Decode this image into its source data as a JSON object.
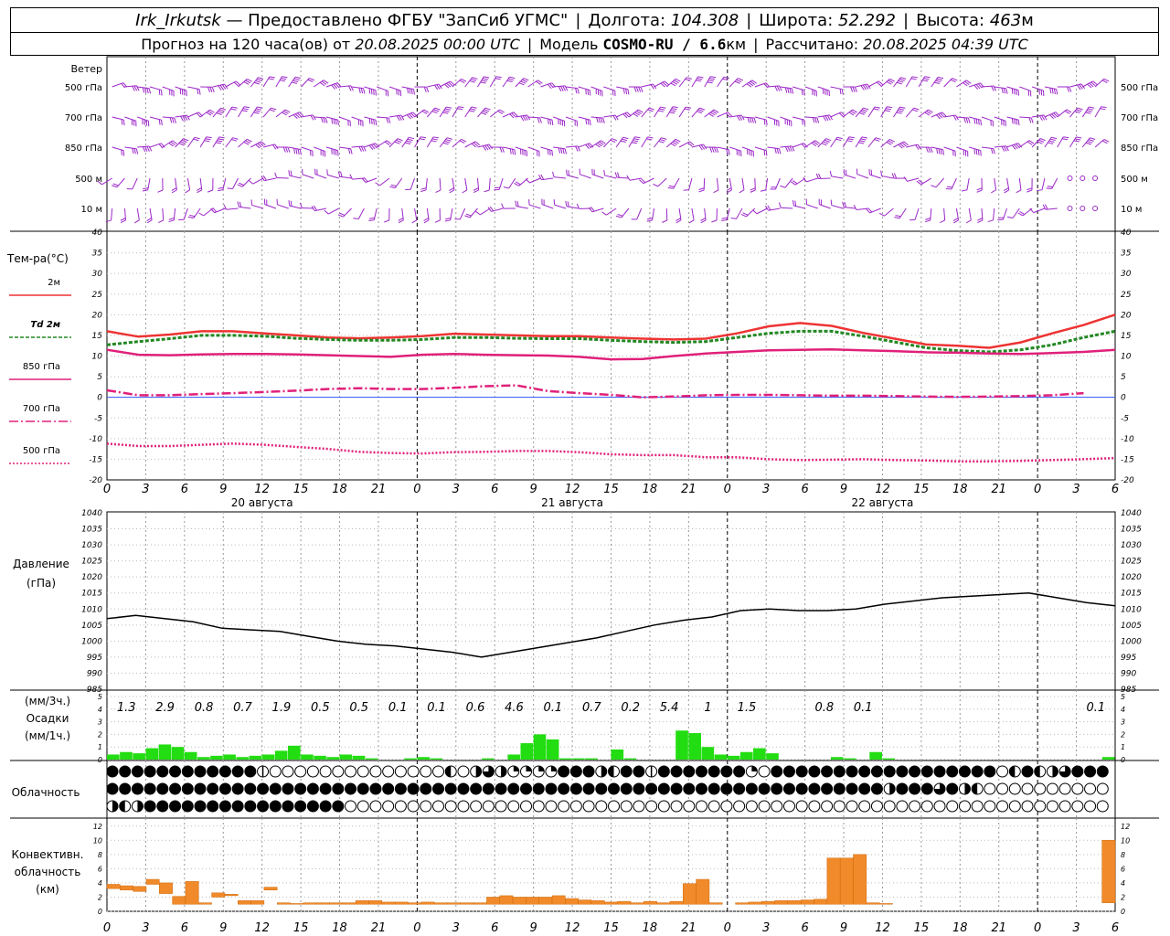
{
  "header": {
    "station": "Irk_Irkutsk",
    "provider": "— Предоставлено ФГБУ \"ЗапСиб УГМС\"",
    "lon_label": "Долгота:",
    "lon": "104.308",
    "lat_label": "Широта:",
    "lat": "52.292",
    "alt_label": "Высота:",
    "alt": "463",
    "alt_unit": "м",
    "forecast_label": "Прогноз на 120 часа(ов) от",
    "forecast_time": "20.08.2025 00:00 UTC",
    "model_label": "Модель",
    "model": "COSMO-RU / 6.6",
    "model_unit": "км",
    "calc_label": "Рассчитано:",
    "calc_time": "20.08.2025 04:39 UTC"
  },
  "panels": {
    "wind_title": "Ветер",
    "wind_levels": [
      "500 гПа",
      "700 гПа",
      "850 гПа",
      "500 м",
      "10 м"
    ],
    "temp_title": "Тем-ра(°С)",
    "temp_legend": [
      {
        "label": "2м",
        "color": "#ee3333",
        "dash": ""
      },
      {
        "label": "Td 2м",
        "color": "#228822",
        "dash": "4,2"
      },
      {
        "label": "850 гПа",
        "color": "#e0207a",
        "dash": ""
      },
      {
        "label": "700 гПа",
        "color": "#e0207a",
        "dash": "10,3,2,3"
      },
      {
        "label": "500 гПа",
        "color": "#e0207a",
        "dash": "2,2"
      }
    ],
    "pressure_title": "Давление",
    "pressure_unit": "(гПа)",
    "precip_unit_3h": "(мм/3ч.)",
    "precip_title": "Осадки",
    "precip_unit_1h": "(мм/1ч.)",
    "cloud_title": "Облачность",
    "conv_title_1": "Конвективн.",
    "conv_title_2": "облачность",
    "conv_unit": "(км)"
  },
  "chart_data": {
    "type": "line",
    "x_hours": [
      0,
      3,
      6,
      9,
      12,
      15,
      18,
      21,
      24,
      27,
      30,
      33,
      36,
      39,
      42,
      45,
      48,
      51,
      54,
      57,
      60,
      63,
      66,
      69,
      72,
      75,
      78
    ],
    "x_tick_labels": [
      "0",
      "3",
      "6",
      "9",
      "12",
      "15",
      "18",
      "21",
      "0",
      "3",
      "6",
      "9",
      "12",
      "15",
      "18",
      "21",
      "0",
      "3",
      "6",
      "9",
      "12",
      "15",
      "18",
      "21",
      "0",
      "3",
      "6"
    ],
    "day_labels": [
      {
        "at_hour": 12,
        "label": "20 августа"
      },
      {
        "at_hour": 36,
        "label": "21 августа"
      },
      {
        "at_hour": 60,
        "label": "22 августа"
      }
    ],
    "temperature": {
      "ylim": [
        -20,
        40
      ],
      "yticks": [
        -20,
        -15,
        -10,
        -5,
        0,
        5,
        10,
        15,
        20,
        25,
        30,
        35,
        40
      ],
      "series": [
        {
          "name": "2м",
          "values": [
            16,
            14.7,
            15.2,
            16,
            16,
            15.5,
            15,
            14.5,
            14.3,
            14.5,
            14.8,
            15.4,
            15.2,
            15,
            14.8,
            14.8,
            14.5,
            14.2,
            14,
            14.2,
            15.5,
            17.2,
            18,
            17.3,
            15.6,
            14.2,
            12.8,
            12.5,
            12,
            13.3,
            15.5,
            17.5,
            20
          ]
        },
        {
          "name": "Td 2м",
          "values": [
            12.7,
            13.5,
            14.2,
            15,
            15,
            14.8,
            14.3,
            14,
            13.8,
            13.8,
            14,
            14.5,
            14.5,
            14.3,
            14.2,
            14.2,
            13.8,
            13.5,
            13.3,
            13.5,
            14.5,
            15.5,
            16,
            16,
            14.8,
            13.4,
            12,
            11.3,
            11,
            11.5,
            12.7,
            14.5,
            16
          ]
        },
        {
          "name": "850 гПа",
          "values": [
            11.5,
            10.3,
            10.2,
            10.4,
            10.5,
            10.5,
            10.4,
            10.2,
            10,
            9.8,
            10.3,
            10.5,
            10.3,
            10.2,
            10.1,
            9.8,
            9.2,
            9.3,
            10,
            10.6,
            11,
            11.4,
            11.5,
            11.6,
            11.4,
            11.2,
            10.9,
            10.8,
            10.6,
            10.5,
            10.7,
            11,
            11.5
          ]
        },
        {
          "name": "700 гПа",
          "values": [
            1.7,
            0.5,
            0.5,
            0.8,
            1,
            1.3,
            1.6,
            2,
            2.2,
            2,
            2,
            2.3,
            2.7,
            2.9,
            1.5,
            1,
            0.6,
            0,
            0.2,
            0.5,
            0.6,
            0.6,
            0.5,
            0.4,
            0.4,
            0.3,
            0.2,
            0.1,
            0.2,
            0.3,
            0.5,
            1
          ]
        },
        {
          "name": "500 гПа",
          "values": [
            -11.2,
            -11.8,
            -11.8,
            -11.5,
            -11.2,
            -11.5,
            -12,
            -12.5,
            -13.2,
            -13.5,
            -13.6,
            -13.3,
            -13.2,
            -13,
            -13,
            -13.3,
            -13.8,
            -14,
            -14,
            -14.5,
            -14.5,
            -15,
            -15.2,
            -15.1,
            -15,
            -15.2,
            -15.3,
            -15.5,
            -15.5,
            -15.4,
            -15.2,
            -15,
            -14.7
          ]
        }
      ],
      "x_step_hours": 2.4375
    },
    "pressure": {
      "ylim": [
        985,
        1040
      ],
      "yticks": [
        985,
        990,
        995,
        1000,
        1005,
        1010,
        1015,
        1020,
        1025,
        1030,
        1035,
        1040
      ],
      "series": [
        {
          "name": "Давление",
          "values": [
            1007,
            1008,
            1007,
            1006,
            1004,
            1003.5,
            1003,
            1001.5,
            1000,
            999,
            998.5,
            997.5,
            996.5,
            995,
            996.5,
            998,
            999.5,
            1001,
            1003,
            1005,
            1006.5,
            1007.5,
            1009.5,
            1010,
            1009.5,
            1009.5,
            1010,
            1011.5,
            1012.5,
            1013.5,
            1014,
            1014.5,
            1015,
            1013.5,
            1012,
            1011
          ]
        }
      ],
      "x_step_hours": 2.2286
    },
    "precip_3h_labels": [
      {
        "at_hour": 1.5,
        "text": "1.3"
      },
      {
        "at_hour": 4.5,
        "text": "2.9"
      },
      {
        "at_hour": 7.5,
        "text": "0.8"
      },
      {
        "at_hour": 10.5,
        "text": "0.7"
      },
      {
        "at_hour": 13.5,
        "text": "1.9"
      },
      {
        "at_hour": 16.5,
        "text": "0.5"
      },
      {
        "at_hour": 19.5,
        "text": "0.5"
      },
      {
        "at_hour": 22.5,
        "text": "0.1"
      },
      {
        "at_hour": 25.5,
        "text": "0.1"
      },
      {
        "at_hour": 28.5,
        "text": "0.6"
      },
      {
        "at_hour": 31.5,
        "text": "4.6"
      },
      {
        "at_hour": 34.5,
        "text": "0.1"
      },
      {
        "at_hour": 37.5,
        "text": "0.7"
      },
      {
        "at_hour": 40.5,
        "text": "0.2"
      },
      {
        "at_hour": 43.5,
        "text": "5.4"
      },
      {
        "at_hour": 46.5,
        "text": "1"
      },
      {
        "at_hour": 49.5,
        "text": "1.5"
      },
      {
        "at_hour": 55.5,
        "text": "0.8"
      },
      {
        "at_hour": 58.5,
        "text": "0.1"
      },
      {
        "at_hour": 76.5,
        "text": "0.1"
      }
    ],
    "precip_1h": {
      "ylim": [
        0,
        5
      ],
      "yticks": [
        0,
        1,
        2,
        3,
        4,
        5
      ],
      "values": [
        0.4,
        0.6,
        0.5,
        0.9,
        1.2,
        1,
        0.6,
        0.2,
        0.3,
        0.4,
        0.2,
        0.3,
        0.4,
        0.7,
        1.1,
        0.4,
        0.3,
        0.2,
        0.4,
        0.3,
        0.1,
        0,
        0,
        0.1,
        0.2,
        0.1,
        0,
        0,
        0,
        0.1,
        0,
        0.4,
        1.3,
        2,
        1.6,
        0.1,
        0.1,
        0.1,
        0,
        0.8,
        0.1,
        0,
        0,
        0,
        2.3,
        2.1,
        1,
        0.4,
        0.3,
        0.6,
        0.9,
        0.5,
        0,
        0,
        0,
        0,
        0.2,
        0.1,
        0,
        0.6,
        0.1,
        0,
        0,
        0,
        0,
        0,
        0,
        0,
        0,
        0,
        0,
        0,
        0,
        0,
        0,
        0,
        0,
        0.2
      ]
    },
    "cloud_cover": {
      "levels": [
        "верхняя",
        "средняя",
        "нижняя"
      ],
      "rows": [
        "FFFFFFFFFFFFPppppppppppppppHphfhqqqqFFFhHFFPFFFFFFFqpFFFFFFFFFFFFFFFFFFpHFHhfFFFhqhHqHFhFFFF",
        "FFFFFFFFFFFFFFFFFFFFFFFFFFFFFFFFFFFFFFFFFFFFFFFFFFFFFFFFFFFFFFhFFFfFhHpppppppppppppppppp",
        "hHhFFFFFFFFFFFFFFFFpppppppppppppppppppppppppppppppppppppppppppppppppppppppppppppppppppppppppppp"
      ]
    },
    "convective": {
      "ylim": [
        0,
        13
      ],
      "yticks": [
        0,
        2,
        4,
        6,
        8,
        10,
        12
      ],
      "bars": [
        [
          3.2,
          3.8
        ],
        [
          3,
          3.6
        ],
        [
          2.8,
          3.5
        ],
        [
          3.8,
          4.5
        ],
        [
          2.5,
          4
        ],
        [
          1,
          2.1
        ],
        [
          1,
          4.2
        ],
        [
          1,
          1.2
        ],
        [
          2,
          2.6
        ],
        [
          2.2,
          2.4
        ],
        [
          1,
          1.5
        ],
        [
          1,
          1.5
        ],
        [
          3,
          3.4
        ],
        [
          1,
          1.2
        ],
        [
          1,
          1.1
        ],
        [
          1,
          1.2
        ],
        [
          1,
          1.2
        ],
        [
          1,
          1.2
        ],
        [
          1,
          1.2
        ],
        [
          1,
          1.5
        ],
        [
          1,
          1.5
        ],
        [
          1,
          1.3
        ],
        [
          1,
          1.3
        ],
        [
          1,
          1.2
        ],
        [
          1,
          1.3
        ],
        [
          1,
          1.2
        ],
        [
          1,
          1.2
        ],
        [
          1,
          1.2
        ],
        [
          1,
          1.2
        ],
        [
          1,
          2
        ],
        [
          1,
          2.2
        ],
        [
          1,
          2
        ],
        [
          1,
          2
        ],
        [
          1,
          2
        ],
        [
          1,
          2.2
        ],
        [
          1,
          1.8
        ],
        [
          1,
          1.6
        ],
        [
          1,
          1.5
        ],
        [
          1,
          1.3
        ],
        [
          1,
          1.4
        ],
        [
          1,
          1.2
        ],
        [
          1,
          1.4
        ],
        [
          1,
          1.2
        ],
        [
          1,
          1.4
        ],
        [
          1,
          3.9
        ],
        [
          1,
          4.5
        ],
        [
          1,
          1.2
        ],
        [
          0,
          0
        ],
        [
          1,
          1.2
        ],
        [
          1,
          1.3
        ],
        [
          1,
          1.4
        ],
        [
          1,
          1.5
        ],
        [
          1,
          1.5
        ],
        [
          1,
          1.6
        ],
        [
          1,
          1.7
        ],
        [
          1,
          7.5
        ],
        [
          1,
          7.5
        ],
        [
          1,
          8
        ],
        [
          1,
          1.2
        ],
        [
          1,
          1.1
        ],
        [
          0,
          0
        ],
        [
          0,
          0
        ],
        [
          0,
          0
        ],
        [
          0,
          0
        ],
        [
          0,
          0
        ],
        [
          0,
          0
        ],
        [
          0,
          0
        ],
        [
          0,
          0
        ],
        [
          0,
          0
        ],
        [
          0,
          0
        ],
        [
          0,
          0
        ],
        [
          0,
          0
        ],
        [
          0,
          0
        ],
        [
          0,
          0
        ],
        [
          0,
          0
        ],
        [
          0,
          0
        ],
        [
          1.2,
          10
        ]
      ]
    }
  }
}
